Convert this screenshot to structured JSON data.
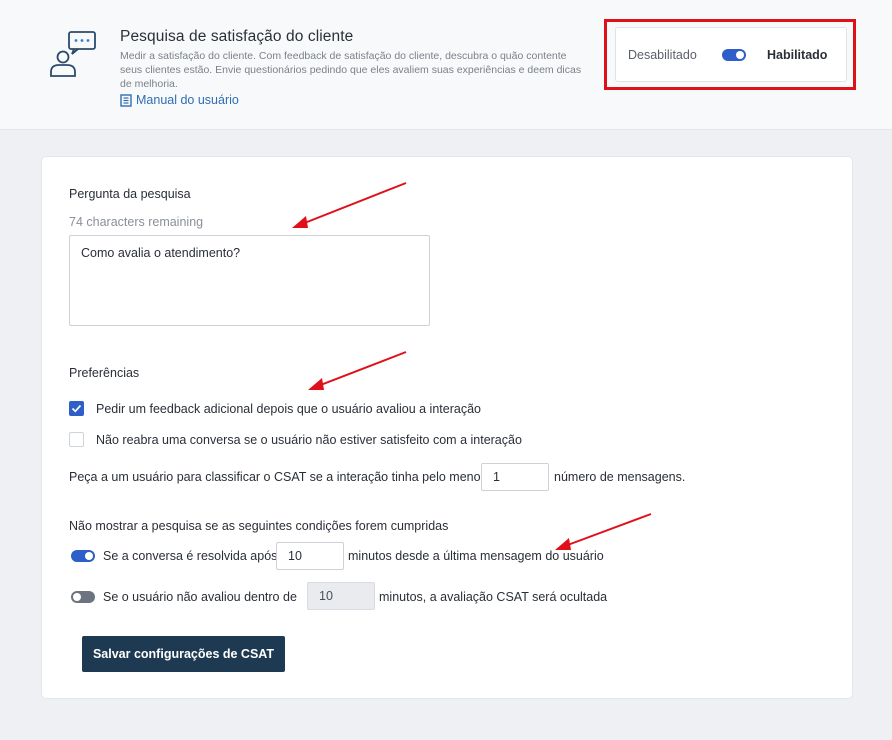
{
  "header": {
    "title": "Pesquisa de satisfação do cliente",
    "description": "Medir a satisfação do cliente. Com feedback de satisfação do cliente, descubra o quão contente seus clientes estão. Envie questionários pedindo que eles avaliem suas experiências e deem dicas de melhoria.",
    "manual_link": "Manual do usuário",
    "icon": "support-chat-icon"
  },
  "status_toggle": {
    "off_label": "Desabilitado",
    "on_label": "Habilitado",
    "enabled": true
  },
  "question": {
    "label": "Pergunta da pesquisa",
    "remaining": "74 characters remaining",
    "value": "Como avalia o atendimento?"
  },
  "preferences": {
    "label": "Preferências",
    "feedback_option": {
      "label": "Pedir um feedback adicional depois que o usuário avaliou a interação",
      "checked": true
    },
    "reopen_option": {
      "label": "Não reabra uma conversa se o usuário não estiver satisfeito com a interação",
      "checked": false
    },
    "min_messages_prefix": "Peça a um usuário para classificar o CSAT se a interação tinha pelo menos",
    "min_messages_value": "1",
    "min_messages_suffix": "número de mensagens."
  },
  "conditions": {
    "label": "Não mostrar a pesquisa se as seguintes condições forem cumpridas",
    "resolved": {
      "enabled": true,
      "prefix": "Se a conversa é resolvida após",
      "value": "10",
      "suffix": "minutos desde a última mensagem do usuário"
    },
    "not_rated": {
      "enabled": false,
      "prefix": "Se o usuário não avaliou dentro de",
      "value": "10",
      "suffix": "minutos, a avaliação CSAT será ocultada"
    }
  },
  "save_button": "Salvar configurações de CSAT",
  "colors": {
    "accent": "#2e5fc8",
    "annotation": "#e0101a",
    "button": "#1e3a52"
  }
}
